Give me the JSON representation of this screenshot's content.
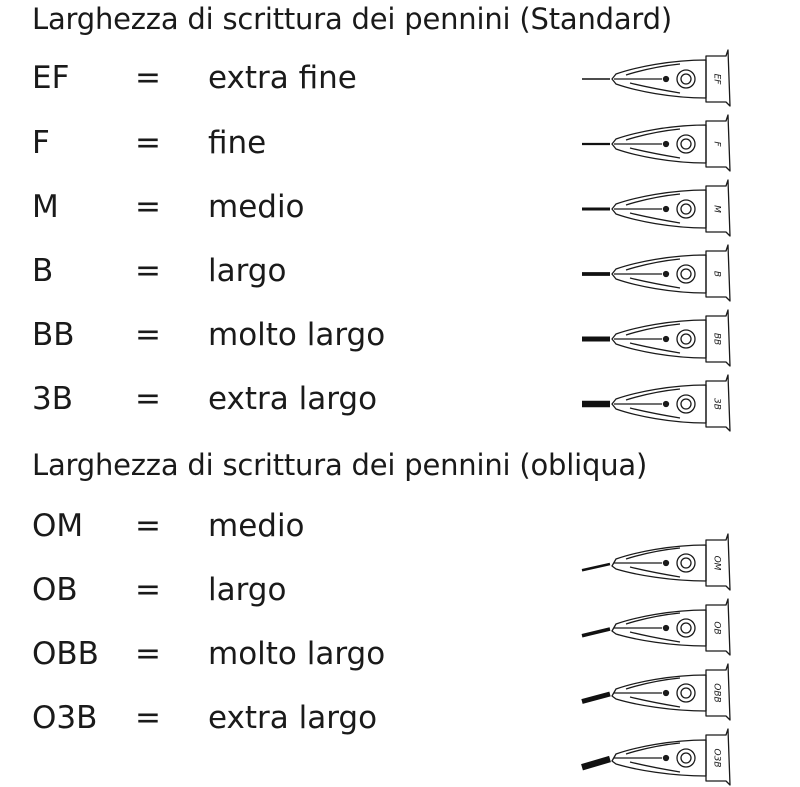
{
  "standard": {
    "title": "Larghezza di scrittura dei pennini (Standard)",
    "rows": [
      {
        "code": "EF",
        "eq": "=",
        "desc": "extra fine",
        "label": "EF",
        "stroke": 1.5
      },
      {
        "code": "F",
        "eq": "=",
        "desc": "fine",
        "label": "F",
        "stroke": 2.2
      },
      {
        "code": "M",
        "eq": "=",
        "desc": "medio",
        "label": "M",
        "stroke": 3.0
      },
      {
        "code": "B",
        "eq": "=",
        "desc": "largo",
        "label": "B",
        "stroke": 3.8
      },
      {
        "code": "BB",
        "eq": "=",
        "desc": "molto largo",
        "label": "BB",
        "stroke": 5.0
      },
      {
        "code": "3B",
        "eq": "=",
        "desc": "extra largo",
        "label": "3B",
        "stroke": 6.5
      }
    ]
  },
  "oblique": {
    "title": "Larghezza di scrittura dei pennini (obliqua)",
    "rows": [
      {
        "code": "OM",
        "eq": "=",
        "desc": "medio",
        "label": "OM",
        "stroke": 2.5
      },
      {
        "code": "OB",
        "eq": "=",
        "desc": "largo",
        "label": "OB",
        "stroke": 3.5
      },
      {
        "code": "OBB",
        "eq": "=",
        "desc": "molto largo",
        "label": "OBB",
        "stroke": 5.0
      },
      {
        "code": "O3B",
        "eq": "=",
        "desc": "extra largo",
        "label": "O3B",
        "stroke": 6.5
      }
    ]
  }
}
